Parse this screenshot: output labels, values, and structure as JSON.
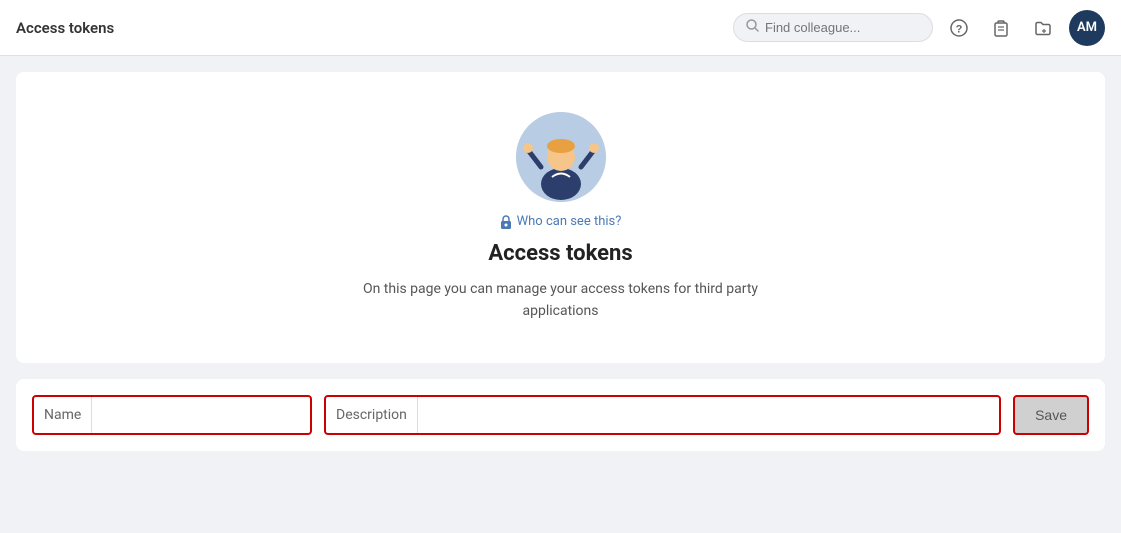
{
  "header": {
    "title": "Access tokens",
    "search": {
      "placeholder": "Find colleague..."
    },
    "avatar": {
      "initials": "AM"
    }
  },
  "card": {
    "who_can_see": "Who can see this?",
    "title": "Access tokens",
    "description": "On this page you can manage your access tokens for third party applications"
  },
  "form": {
    "name_label": "Name",
    "description_label": "Description",
    "save_label": "Save"
  },
  "icons": {
    "search": "🔍",
    "help": "?",
    "clipboard": "📋",
    "folder": "📁",
    "lock": "🔒"
  }
}
